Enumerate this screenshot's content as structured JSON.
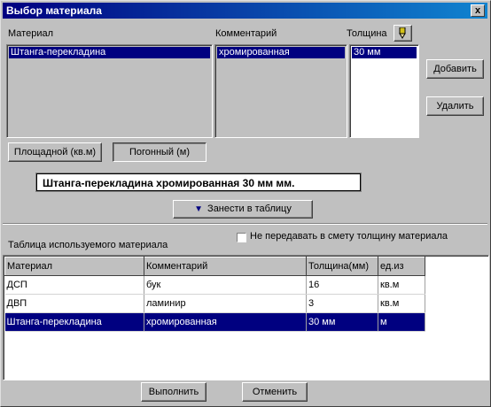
{
  "window": {
    "title": "Выбор материала",
    "close_label": "x"
  },
  "material_section": {
    "material_label": "Материал",
    "comment_label": "Комментарий",
    "thickness_label": "Толщина",
    "material_selected": "Штанга-перекладина",
    "comment_selected": "хромированная",
    "thickness_selected": "30 мм"
  },
  "buttons": {
    "add": "Добавить",
    "delete": "Удалить",
    "area": "Площадной (кв.м)",
    "linear": "Погонный (м)",
    "enter_to_table": "Занести в таблицу",
    "execute": "Выполнить",
    "cancel": "Отменить"
  },
  "result_text": "Штанга-перекладина  хромированная  30 мм мм.",
  "table_section": {
    "title": "Таблица используемого материала",
    "checkbox_label": "Не передавать в смету толщину материала",
    "checkbox_checked": false,
    "columns": [
      "Материал",
      "Комментарий",
      "Толщина(мм)",
      "ед.из"
    ],
    "rows": [
      [
        "ДСП",
        "бук",
        "16",
        "кв.м"
      ],
      [
        "ДВП",
        "ламинир",
        "3",
        "кв.м"
      ],
      [
        "Штанга-перекладина",
        "хромированная",
        "30 мм",
        "м"
      ]
    ],
    "selected_row": 2
  },
  "colors": {
    "selection": "#000080",
    "face": "#c0c0c0"
  }
}
